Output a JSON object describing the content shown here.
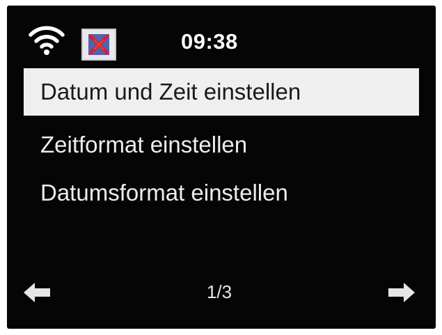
{
  "status_bar": {
    "wifi_icon": "wifi-icon",
    "station_icon": "station-logo-icon",
    "time": "09:38"
  },
  "menu": {
    "items": [
      {
        "label": "Datum und Zeit einstellen",
        "selected": true
      },
      {
        "label": "Zeitformat einstellen",
        "selected": false
      },
      {
        "label": "Datumsformat einstellen",
        "selected": false
      }
    ]
  },
  "footer": {
    "page_indicator": "1/3",
    "prev_icon": "arrow-left-icon",
    "next_icon": "arrow-right-icon"
  },
  "colors": {
    "background": "#050505",
    "selection": "#efefef",
    "text": "#f2f2f2",
    "selected_text": "#1a1a1a"
  }
}
